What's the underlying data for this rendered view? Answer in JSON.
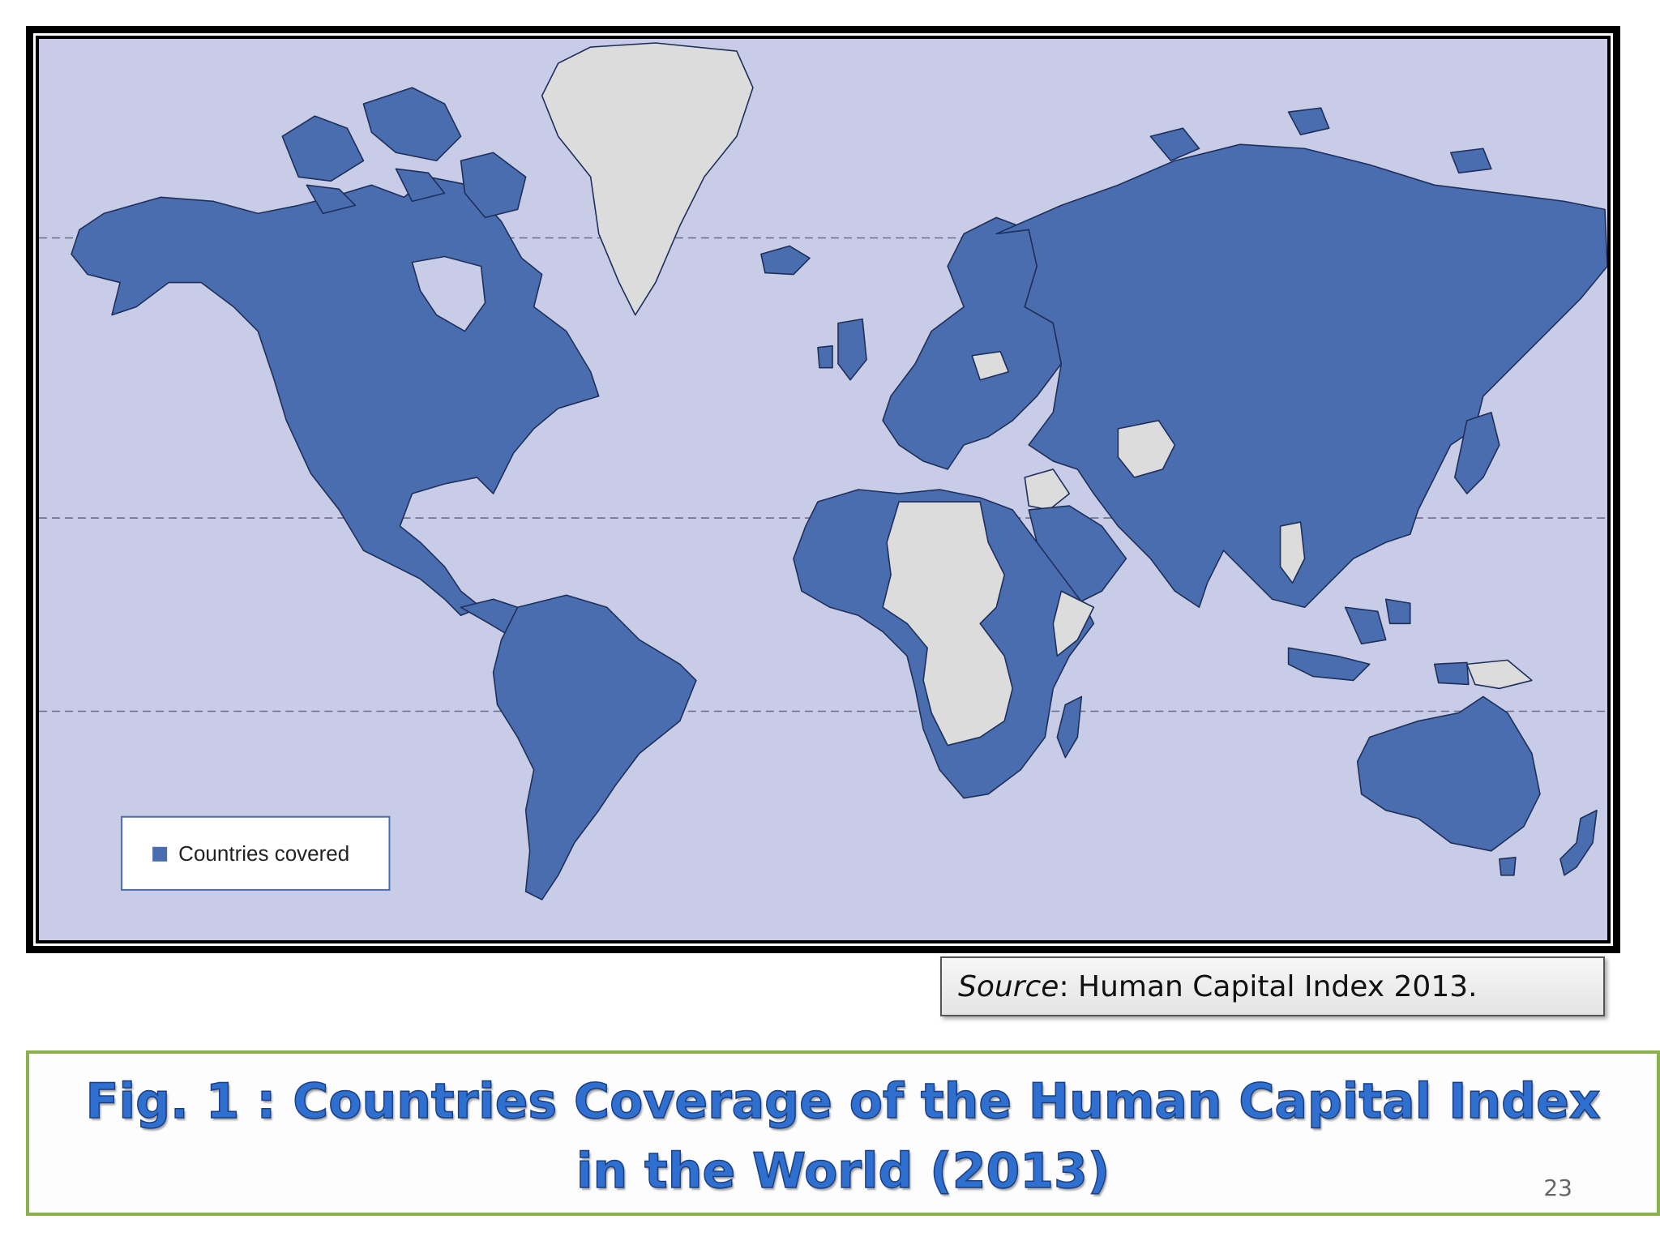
{
  "map": {
    "legend_label": "Countries covered",
    "colors": {
      "ocean": "#c8cce6",
      "covered": "#4a6db0",
      "not_covered": "#dcdcdc",
      "border": "#1e2f5a"
    },
    "not_covered_regions": [
      "Greenland",
      "Libya",
      "Chad",
      "Sudan",
      "Niger",
      "Central African Republic",
      "Democratic Republic of the Congo",
      "Angola",
      "Zambia",
      "Zimbabwe",
      "Somalia",
      "Afghanistan",
      "Turkmenistan",
      "Uzbekistan",
      "Belarus",
      "Syria",
      "Iraq",
      "Myanmar",
      "Papua New Guinea",
      "Western Sahara"
    ]
  },
  "source": {
    "label": "Source",
    "text": ":  Human Capital Index 2013."
  },
  "caption": {
    "title": "Fig. 1 : Countries Coverage of the Human Capital Index in the World (2013)",
    "page_number": "23"
  }
}
